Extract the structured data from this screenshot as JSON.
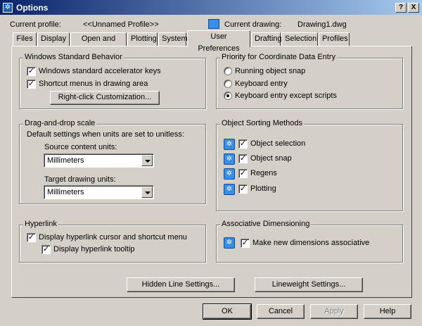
{
  "window": {
    "title": "Options",
    "help_glyph": "?",
    "close_glyph": "X"
  },
  "profile": {
    "label": "Current profile:",
    "value": "<<Unnamed Profile>>",
    "drawing_label": "Current drawing:",
    "drawing_value": "Drawing1.dwg"
  },
  "tabs": [
    {
      "label": "Files"
    },
    {
      "label": "Display"
    },
    {
      "label": "Open and Save"
    },
    {
      "label": "Plotting"
    },
    {
      "label": "System"
    },
    {
      "label": "User Preferences"
    },
    {
      "label": "Drafting"
    },
    {
      "label": "Selection"
    },
    {
      "label": "Profiles"
    }
  ],
  "active_tab": "User Preferences",
  "windows_behavior": {
    "title": "Windows Standard Behavior",
    "accelerator_label": "Windows standard accelerator keys",
    "accelerator_checked": true,
    "shortcut_label": "Shortcut menus in drawing area",
    "shortcut_checked": true,
    "customize_button": "Right-click Customization..."
  },
  "drag_drop": {
    "title": "Drag-and-drop scale",
    "description": "Default settings when units are set to unitless:",
    "source_label": "Source content units:",
    "source_value": "Millimeters",
    "target_label": "Target drawing units:",
    "target_value": "Millimeters"
  },
  "hyperlink": {
    "title": "Hyperlink",
    "cursor_label": "Display hyperlink cursor and shortcut menu",
    "cursor_checked": true,
    "tooltip_label": "Display hyperlink tooltip",
    "tooltip_checked": true
  },
  "coordinate_priority": {
    "title": "Priority for Coordinate Data Entry",
    "options": [
      {
        "label": "Running object snap",
        "selected": false
      },
      {
        "label": "Keyboard entry",
        "selected": false
      },
      {
        "label": "Keyboard entry except scripts",
        "selected": true
      }
    ]
  },
  "object_sorting": {
    "title": "Object Sorting Methods",
    "items": [
      {
        "label": "Object selection",
        "checked": true
      },
      {
        "label": "Object snap",
        "checked": true
      },
      {
        "label": "Regens",
        "checked": true
      },
      {
        "label": "Plotting",
        "checked": true
      }
    ]
  },
  "assoc_dim": {
    "title": "Associative Dimensioning",
    "label": "Make new dimensions associative",
    "checked": true
  },
  "buttons": {
    "hidden_line": "Hidden Line Settings...",
    "lineweight": "Lineweight Settings...",
    "ok": "OK",
    "cancel": "Cancel",
    "apply": "Apply",
    "help": "Help"
  },
  "check_glyph": "✓"
}
